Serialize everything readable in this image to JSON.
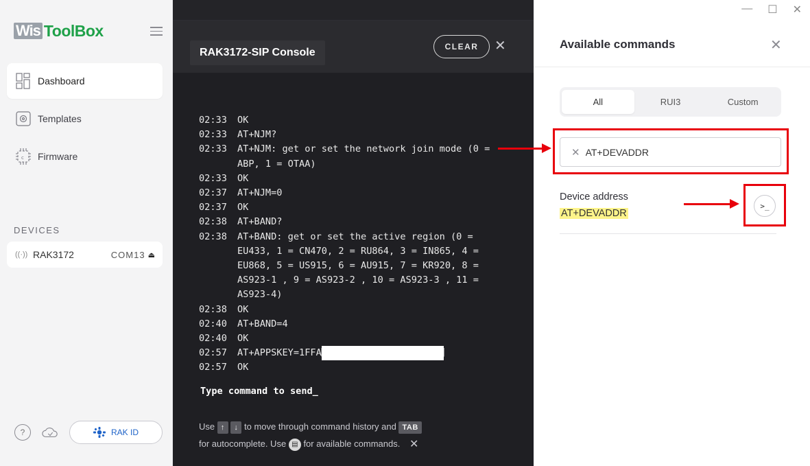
{
  "sidebar": {
    "logo": {
      "part1": "Wis",
      "part2": "ToolBox"
    },
    "nav": [
      {
        "label": "Dashboard",
        "icon": "dashboard-icon"
      },
      {
        "label": "Templates",
        "icon": "templates-icon"
      },
      {
        "label": "Firmware",
        "icon": "chip-icon"
      }
    ],
    "devices_header": "DEVICES",
    "device": {
      "name": "RAK3172",
      "port": "COM13",
      "icon": "signal-icon"
    },
    "footer": {
      "rakid_label": "RAK ID"
    }
  },
  "console": {
    "title": "RAK3172-SIP Console",
    "clear_label": "CLEAR",
    "log": [
      {
        "time": "02:33",
        "text": "OK"
      },
      {
        "time": "02:33",
        "text": "AT+NJM?"
      },
      {
        "time": "02:33",
        "text": "AT+NJM: get or set the network join mode (0 = ABP, 1 = OTAA)"
      },
      {
        "time": "02:33",
        "text": "OK"
      },
      {
        "time": "02:37",
        "text": "AT+NJM=0"
      },
      {
        "time": "02:37",
        "text": "OK"
      },
      {
        "time": "02:38",
        "text": "AT+BAND?"
      },
      {
        "time": "02:38",
        "text": "AT+BAND: get or set the active region (0 = EU433, 1 = CN470, 2 = RU864, 3 = IN865, 4 = EU868, 5 = US915, 6 = AU915, 7 = KR920, 8 = AS923-1 , 9 = AS923-2 , 10 = AS923-3 , 11 = AS923-4)"
      },
      {
        "time": "02:38",
        "text": "OK"
      },
      {
        "time": "02:40",
        "text": "AT+BAND=4"
      },
      {
        "time": "02:40",
        "text": "OK"
      },
      {
        "time": "02:57",
        "text": "AT+APPSKEY=1FFA"
      },
      {
        "time": "02:57",
        "text": "OK"
      }
    ],
    "prompt": "Type command to send_",
    "hint": {
      "use": "Use",
      "key_up": "↑",
      "key_down": "↓",
      "middle": "to move through command history and",
      "key_tab": "TAB",
      "line2_a": "for autocomplete. Use",
      "line2_b": "for available commands."
    }
  },
  "panel": {
    "title": "Available commands",
    "tabs": [
      {
        "label": "All",
        "active": true
      },
      {
        "label": "RUI3",
        "active": false
      },
      {
        "label": "Custom",
        "active": false
      }
    ],
    "search": {
      "value": "AT+DEVADDR"
    },
    "result": {
      "title": "Device address",
      "command": "AT+DEVADDR"
    }
  },
  "colors": {
    "accent_green": "#1fa149",
    "annotation_red": "#e8000b",
    "highlight": "#fdf48a"
  }
}
